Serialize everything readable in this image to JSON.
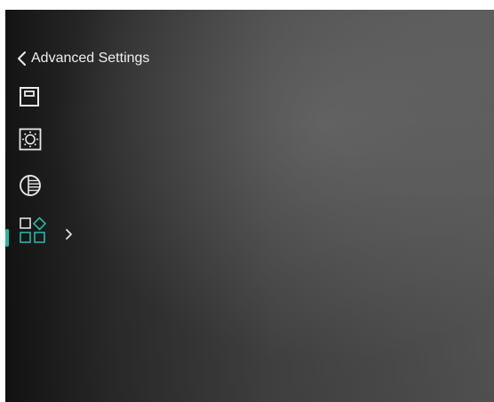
{
  "header": {
    "back_icon": "chevron-left-icon",
    "title": "Advanced Settings"
  },
  "menu": {
    "items": [
      {
        "icon": "display-frame-icon",
        "active": false
      },
      {
        "icon": "brightness-icon",
        "active": false
      },
      {
        "icon": "contrast-icon",
        "active": false
      },
      {
        "icon": "function-settings-icon",
        "active": true,
        "submenu_icon": "chevron-right-icon"
      }
    ]
  },
  "colors": {
    "accent": "#29c4b5",
    "icon": "#f2f2f2",
    "text": "#f2f2f2"
  }
}
